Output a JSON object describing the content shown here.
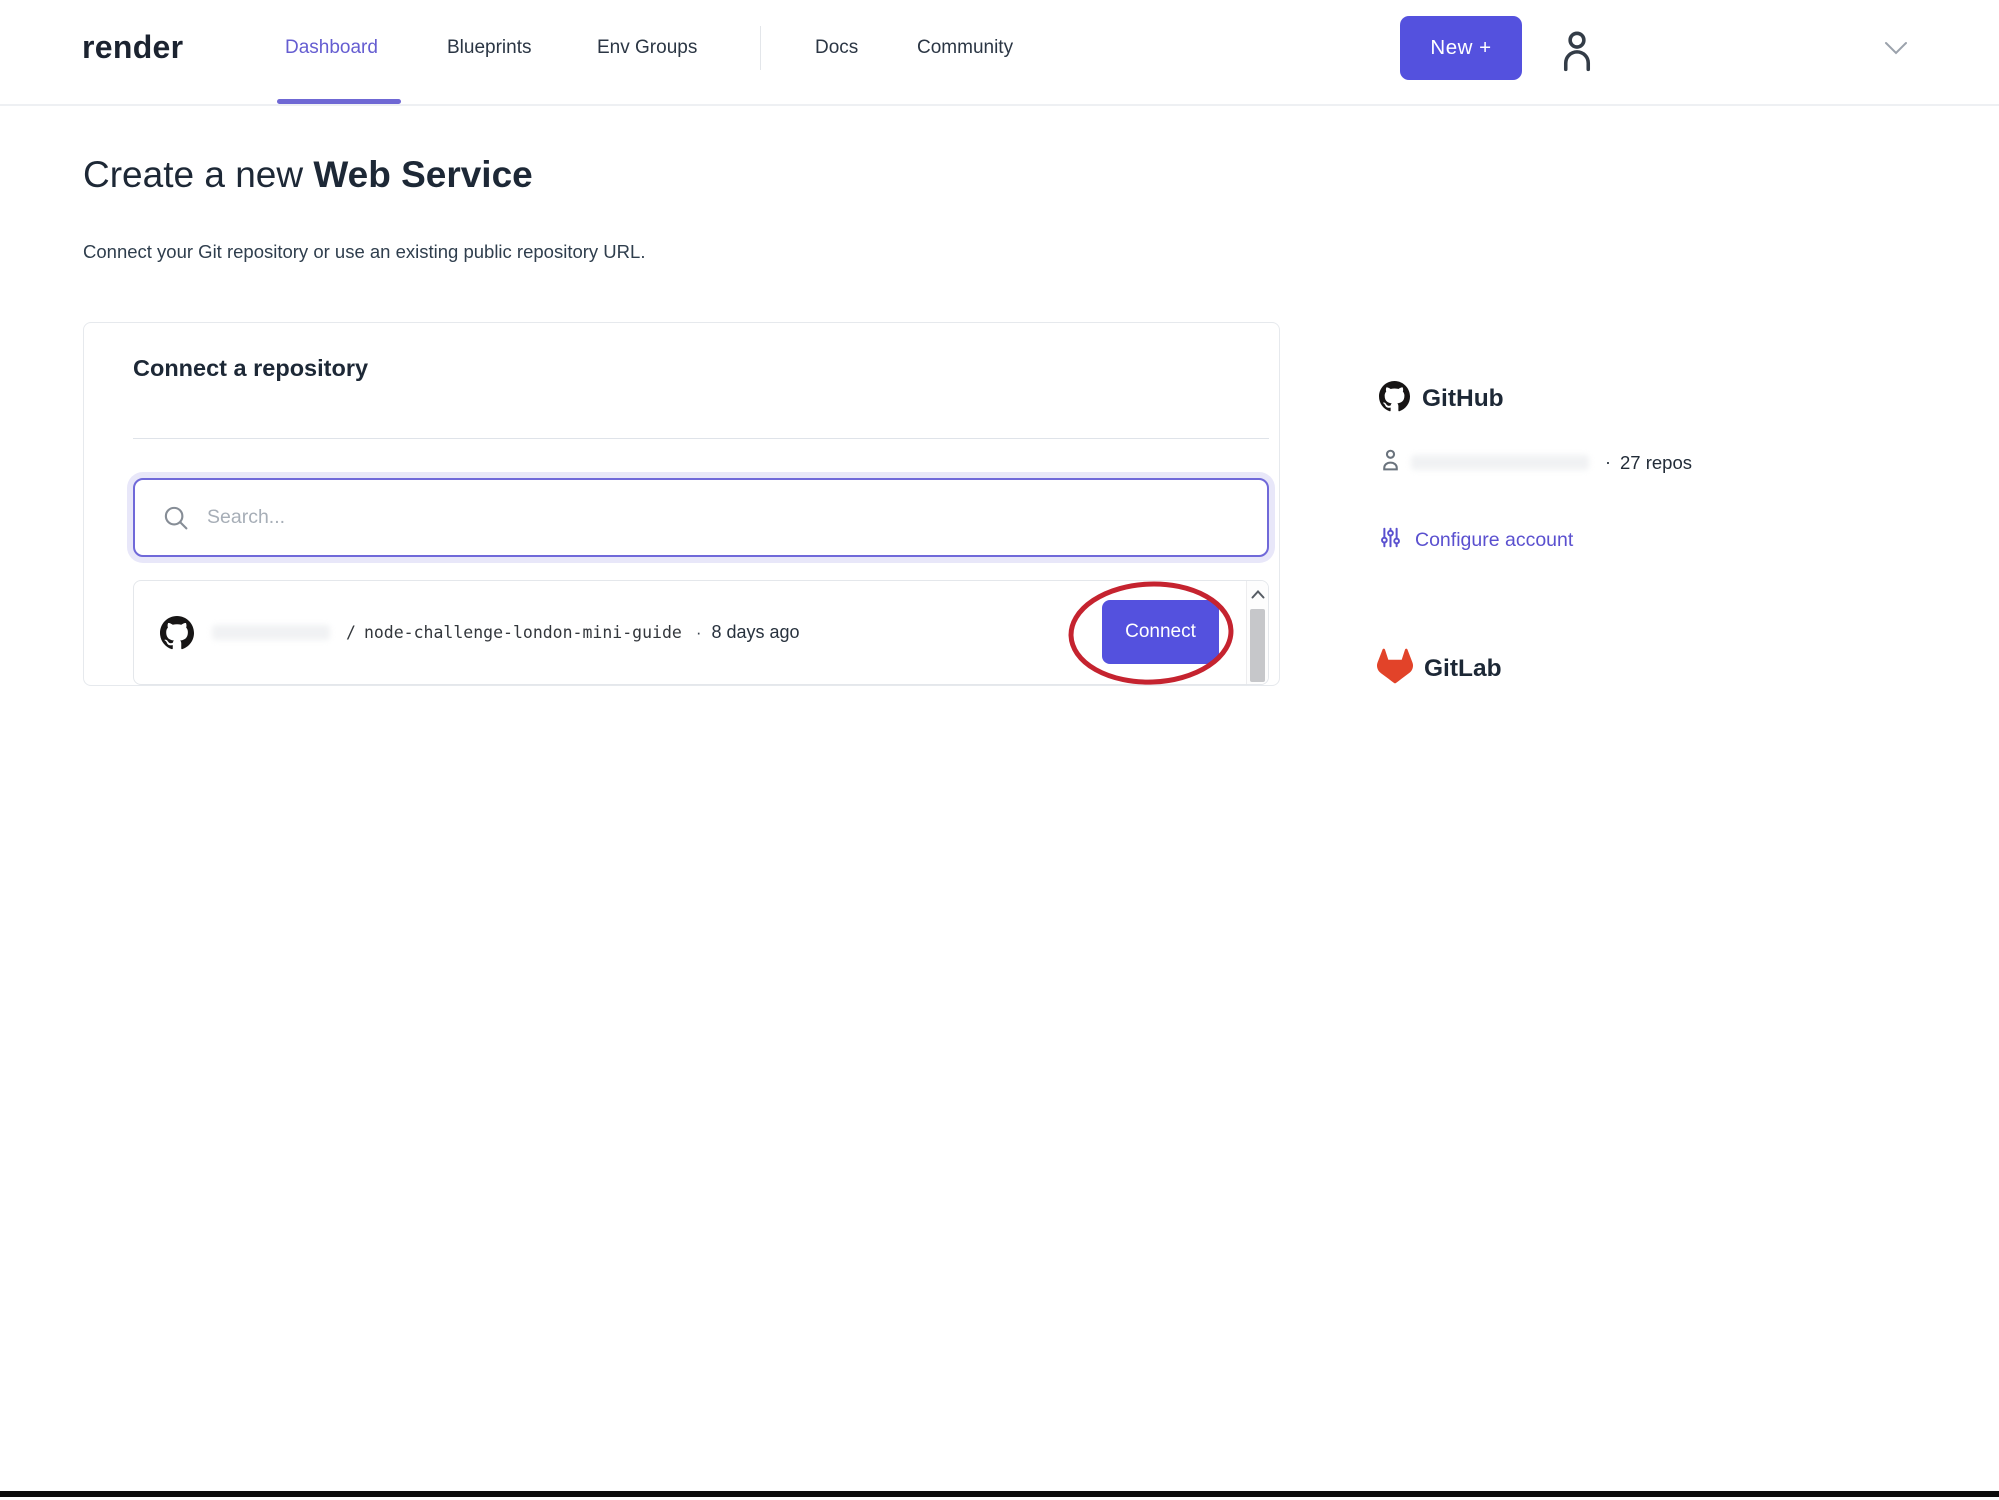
{
  "brand": {
    "logo": "render"
  },
  "nav": {
    "items": [
      {
        "label": "Dashboard",
        "active": true
      },
      {
        "label": "Blueprints",
        "active": false
      },
      {
        "label": "Env Groups",
        "active": false
      },
      {
        "label": "Docs",
        "active": false
      },
      {
        "label": "Community",
        "active": false
      }
    ],
    "new_button_label": "New +"
  },
  "page": {
    "title_regular": "Create a new ",
    "title_bold": "Web Service",
    "subtitle": "Connect your Git repository or use an existing public repository URL."
  },
  "card": {
    "heading": "Connect a repository",
    "search_placeholder": "Search...",
    "repo": {
      "path_prefix": "/",
      "name": "node-challenge-london-mini-guide",
      "separator": "·",
      "updated": "8 days ago",
      "connect_label": "Connect"
    }
  },
  "sidebar": {
    "github": {
      "title": "GitHub",
      "bullet": "·",
      "repos_count": "27 repos",
      "configure_label": "Configure account"
    },
    "gitlab": {
      "title": "GitLab"
    }
  },
  "icons": {
    "nav": [
      "user-icon",
      "chevron-down-icon"
    ],
    "card": [
      "search-icon",
      "github-mark-icon",
      "scroll-up-icon"
    ],
    "sidebar": [
      "github-mark-icon",
      "user-icon",
      "sliders-icon",
      "gitlab-fox-icon"
    ],
    "annotation": "red-ellipse-highlight"
  },
  "colors": {
    "accent_indigo": "#5451de",
    "nav_active": "#655dd1",
    "link_purple": "#5a50cf",
    "annotation_red": "#c5232f",
    "gitlab_orange": "#e24329",
    "text_dark": "#1d2836"
  }
}
